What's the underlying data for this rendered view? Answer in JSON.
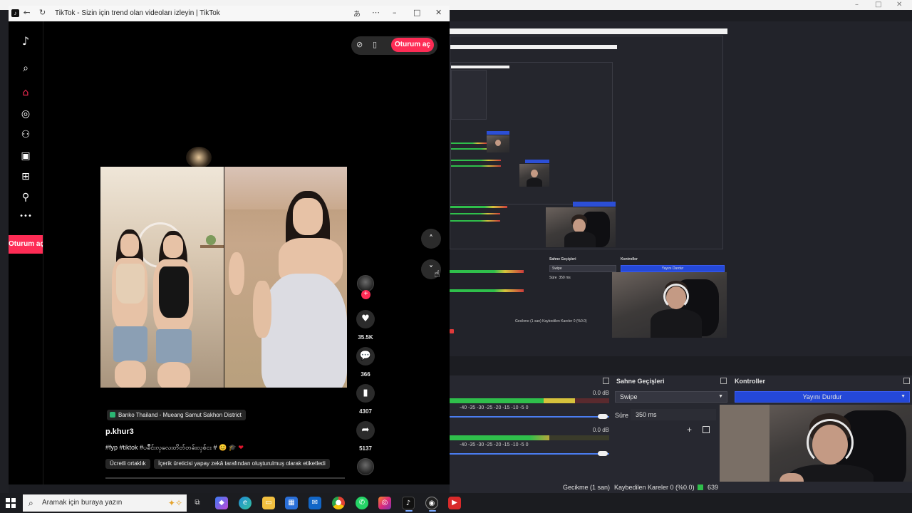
{
  "browser": {
    "tab_title": "TikTok - Sizin için trend olan videoları izleyin | TikTok",
    "translate_icon": "translate-icon",
    "window_controls": {
      "minimize": "–",
      "maximize": "□",
      "close": "✕"
    },
    "nav": {
      "back": "←",
      "forward": "→",
      "reload": "↻",
      "more": "⋯"
    }
  },
  "tiktok": {
    "login_label": "Oturum aç",
    "sidebar_login_label": "Oturum aç",
    "sidebar_icons": [
      "tiktok-logo-icon",
      "search-icon",
      "home-icon",
      "explore-icon",
      "following-icon",
      "live-icon",
      "upload-icon",
      "profile-icon",
      "more-icon"
    ],
    "nav_up": "˄",
    "nav_down": "˅",
    "actions": {
      "likes": "35.5K",
      "comments": "366",
      "saves": "4307",
      "shares": "5137"
    },
    "video": {
      "location": "Banko Thailand - Mueang Samut Sakhon District",
      "username": "p.khur3",
      "caption": "#fyp #tiktok #ပခ်ိဳင်းလှလေးတိတ်တခ်းလှစ်ငး #",
      "caption_emojis": "😊 🎓",
      "heart": "❤",
      "chips": [
        "Ücretli ortaklık",
        "İçerik üreticisi yapay zekâ tarafından oluşturulmuş olarak etiketledi"
      ]
    }
  },
  "obs": {
    "scene_transitions_title": "Sahne Geçişleri",
    "controls_title": "Kontroller",
    "transition_value": "Swipe",
    "duration_label": "Süre",
    "duration_value": "350 ms",
    "stop_stream": "Yayını Durdur",
    "mixer_db_1": "0.0 dB",
    "mixer_db_2": "0.0 dB",
    "mixer_ticks": "-40  -35  -30  -25  -20  -15  -10  -5  0",
    "status_delay": "Gecikme (1 san)",
    "status_dropped": "Kaybedilen Kareler 0 (%0.0)",
    "status_bitrate": "639",
    "mini_stop": "Yayını Durdur",
    "mini_controls": "Kontroller",
    "mini_transitions": "Sahne Geçişleri",
    "mini_swipe": "Swipe",
    "mini_duration": "Süre",
    "mini_ms": "350 ms",
    "mini_status": "Gecikme (1 san)   Kaybedilen Kareler 0 (%0.0)"
  },
  "taskbar": {
    "search_placeholder": "Aramak için buraya yazın",
    "apps": [
      "task-view-icon",
      "copilot-icon",
      "edge-icon",
      "file-explorer-icon",
      "store-icon",
      "outlook-icon",
      "chrome-icon",
      "whatsapp-icon",
      "instagram-icon",
      "tiktok-icon",
      "obs-icon",
      "app-red-icon"
    ]
  },
  "colors": {
    "tiktok_red": "#fe2c55",
    "obs_blue": "#2448d8",
    "meter_green": "#2fbf4b"
  }
}
